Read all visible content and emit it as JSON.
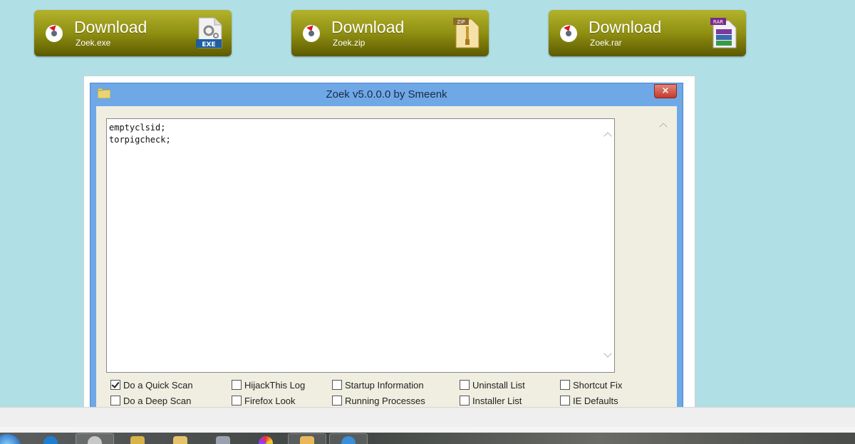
{
  "downloads": [
    {
      "title": "Download",
      "file": "Zoek.exe",
      "badge": "EXE",
      "badge_color": "#1d5fa3"
    },
    {
      "title": "Download",
      "file": "Zoek.zip",
      "badge": "ZIP",
      "badge_color": "#d8a73a"
    },
    {
      "title": "Download",
      "file": "Zoek.rar",
      "badge": "RAR",
      "badge_color": "#7a2a8a"
    }
  ],
  "window": {
    "title": "Zoek v5.0.0.0 by Smeenk",
    "close_label": "×"
  },
  "editor": {
    "lines": [
      "emptyclsid;",
      "torpigcheck;"
    ]
  },
  "options": {
    "quick_scan": {
      "label": "Do a Quick Scan",
      "checked": true
    },
    "deep_scan": {
      "label": "Do a Deep Scan",
      "checked": false
    },
    "hijackthis_log": {
      "label": "HijackThis Log",
      "checked": false
    },
    "firefox_look": {
      "label": "Firefox Look",
      "checked": false
    },
    "startup_information": {
      "label": "Startup Information",
      "checked": false
    },
    "running_processes": {
      "label": "Running Processes",
      "checked": false
    },
    "uninstall_list": {
      "label": "Uninstall List",
      "checked": false
    },
    "installer_list": {
      "label": "Installer List",
      "checked": false
    },
    "shortcut_fix": {
      "label": "Shortcut Fix",
      "checked": false
    },
    "ie_defaults": {
      "label": "IE Defaults",
      "checked": false
    }
  },
  "taskbar": {
    "icons": [
      "app-icon",
      "folder-icon",
      "plane-icon",
      "picasa-icon",
      "mail-icon",
      "ie-icon"
    ]
  },
  "colors": {
    "page_bg": "#b0dfe5",
    "button_olive": "#8f8f12",
    "window_border": "#6fa8e6",
    "close_red": "#c73a2b"
  }
}
